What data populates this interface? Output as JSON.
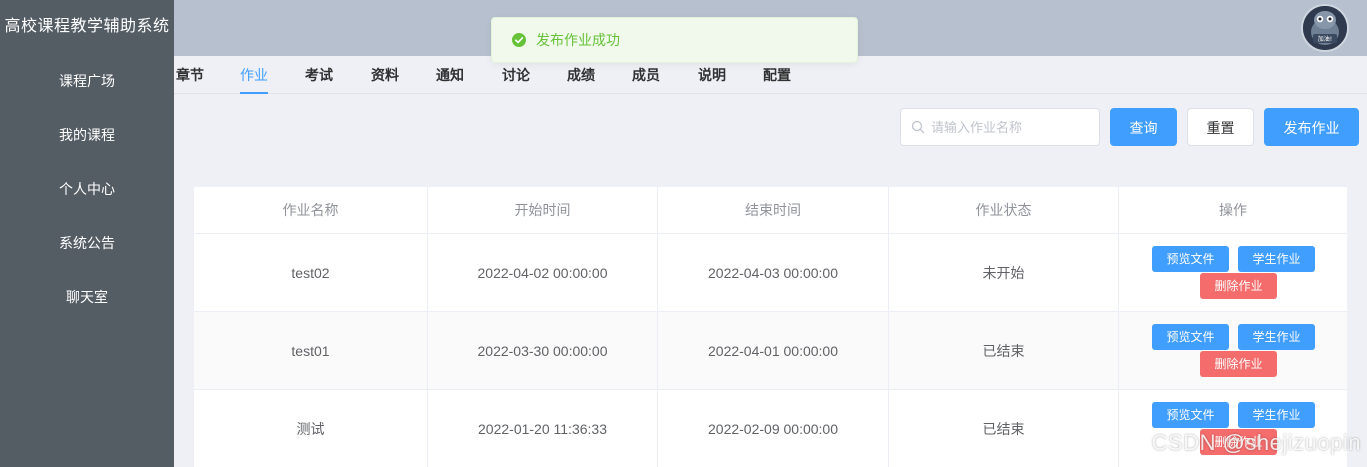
{
  "sidebar": {
    "brand": "高校课程教学辅助系统",
    "items": [
      {
        "label": "课程广场"
      },
      {
        "label": "我的课程"
      },
      {
        "label": "个人中心"
      },
      {
        "label": "系统公告"
      },
      {
        "label": "聊天室"
      }
    ]
  },
  "header": {
    "avatar_text": "加油!"
  },
  "tabs": [
    {
      "label": "章节"
    },
    {
      "label": "作业",
      "active": true
    },
    {
      "label": "考试"
    },
    {
      "label": "资料"
    },
    {
      "label": "通知"
    },
    {
      "label": "讨论"
    },
    {
      "label": "成绩"
    },
    {
      "label": "成员"
    },
    {
      "label": "说明"
    },
    {
      "label": "配置"
    }
  ],
  "toolbar": {
    "search_placeholder": "请输入作业名称",
    "query_label": "查询",
    "reset_label": "重置",
    "publish_label": "发布作业"
  },
  "toast": {
    "message": "发布作业成功",
    "color": "#67c23a"
  },
  "table": {
    "columns": [
      "作业名称",
      "开始时间",
      "结束时间",
      "作业状态",
      "操作"
    ],
    "rows": [
      {
        "name": "test02",
        "start": "2022-04-02 00:00:00",
        "end": "2022-04-03 00:00:00",
        "status": "未开始"
      },
      {
        "name": "test01",
        "start": "2022-03-30 00:00:00",
        "end": "2022-04-01 00:00:00",
        "status": "已结束"
      },
      {
        "name": "测试",
        "start": "2022-01-20 11:36:33",
        "end": "2022-02-09 00:00:00",
        "status": "已结束"
      }
    ],
    "actions": {
      "preview": "预览文件",
      "student": "学生作业",
      "delete": "删除作业"
    }
  },
  "watermark": "CSDN @shejizuopin",
  "colors": {
    "primary": "#409eff",
    "danger": "#f56c6c",
    "sidebar": "#545c64",
    "header": "#b7c0cf"
  }
}
